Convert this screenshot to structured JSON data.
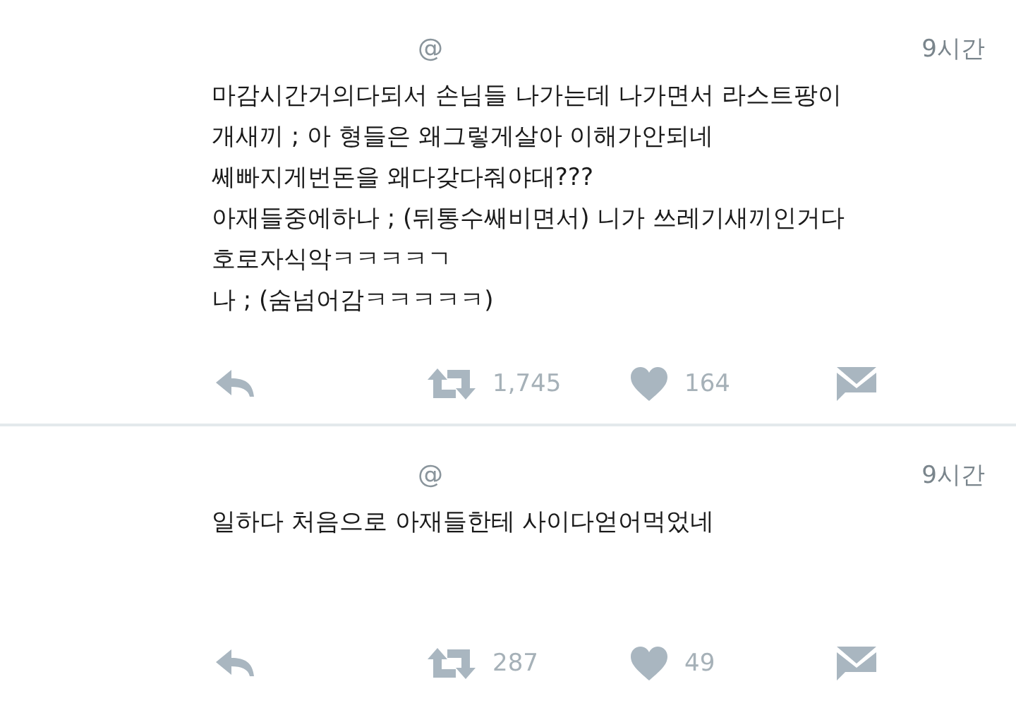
{
  "tweets": [
    {
      "handle": "@",
      "time": "9시간",
      "text": "마감시간거의다되서 손님들 나가는데 나가면서 라스트팡이\n개새끼 ; 아 형들은 왜그렇게살아 이해가안되네\n쎄빠지게번돈을 왜다갖다줘야대???\n아재들중에하나 ; (뒤통수쌔비면서) 니가 쓰레기새끼인거다\n호로자식악ㅋㅋㅋㅋㄱ\n나 ; (숨넘어감ㅋㅋㅋㅋㅋ)",
      "retweets": "1,745",
      "likes": "164"
    },
    {
      "handle": "@",
      "time": "9시간",
      "text": "일하다 처음으로 아재들한테 사이다얻어먹었네",
      "retweets": "287",
      "likes": "49"
    }
  ]
}
